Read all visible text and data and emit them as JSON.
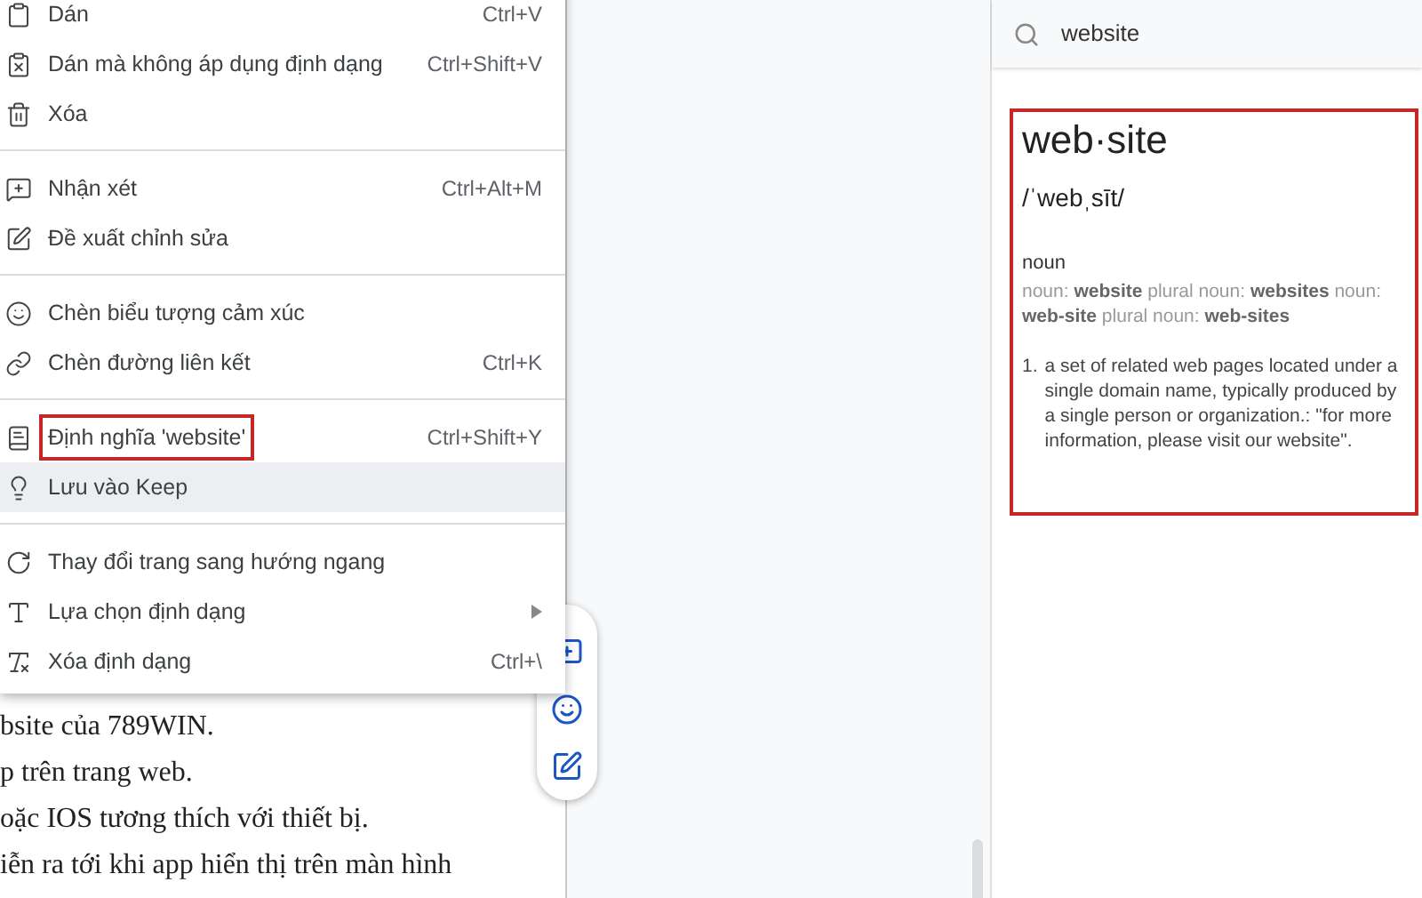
{
  "context_menu": {
    "groups": [
      [
        {
          "label": "Dán",
          "shortcut": "Ctrl+V",
          "selected": false,
          "annotated": false,
          "submenu": false
        },
        {
          "label": "Dán mà không áp dụng định dạng",
          "shortcut": "Ctrl+Shift+V",
          "selected": false,
          "annotated": false,
          "submenu": false
        },
        {
          "label": "Xóa",
          "selected": false,
          "annotated": false,
          "submenu": false
        }
      ],
      [
        {
          "label": "Nhận xét",
          "shortcut": "Ctrl+Alt+M",
          "selected": false,
          "annotated": false,
          "submenu": false
        },
        {
          "label": "Đề xuất chỉnh sửa",
          "selected": false,
          "annotated": false,
          "submenu": false
        }
      ],
      [
        {
          "label": "Chèn biểu tượng cảm xúc",
          "selected": false,
          "annotated": false,
          "submenu": false
        },
        {
          "label": "Chèn đường liên kết",
          "shortcut": "Ctrl+K",
          "selected": false,
          "annotated": false,
          "submenu": false
        }
      ],
      [
        {
          "label": "Định nghĩa 'website'",
          "shortcut": "Ctrl+Shift+Y",
          "selected": false,
          "annotated": true,
          "submenu": false
        },
        {
          "label": "Lưu vào Keep",
          "selected": true,
          "annotated": false,
          "submenu": false
        }
      ],
      [
        {
          "label": "Thay đổi trang sang hướng ngang",
          "selected": false,
          "annotated": false,
          "submenu": false
        },
        {
          "label": "Lựa chọn định dạng",
          "selected": false,
          "annotated": false,
          "submenu": true
        },
        {
          "label": "Xóa định dạng",
          "shortcut": "Ctrl+\\",
          "selected": false,
          "annotated": false,
          "submenu": false
        }
      ]
    ]
  },
  "document": {
    "lines": [
      "bsite của 789WIN.",
      "p trên trang web.",
      "oặc IOS tương thích với thiết bị.",
      "iễn ra tới khi app hiển thị trên màn hình"
    ]
  },
  "dictionary": {
    "search": {
      "value": "website"
    },
    "entry": {
      "annotated": true,
      "headword": "web·site",
      "pronunciation": "/ˈwebˌsīt/",
      "part_of_speech": "noun",
      "forms": "noun: **website** plural noun: **websites** noun: **web-site** plural noun: **web-sites**",
      "definitions": [
        {
          "number": "1.",
          "text": "a set of related web pages located under a single domain name, typically produced by a single person or organization.: \"for more information, please visit our website\"."
        }
      ]
    }
  }
}
